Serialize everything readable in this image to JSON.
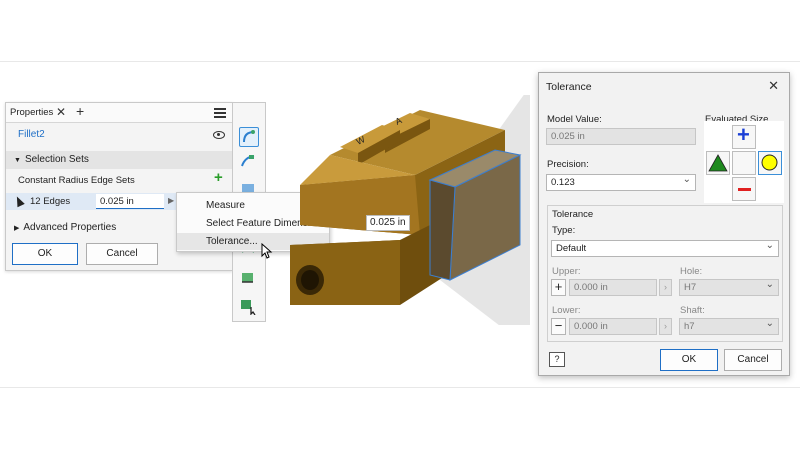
{
  "properties": {
    "tab_label": "Properties",
    "tab_close": "✕",
    "tab_add": "+",
    "feature_name": "Fillet2",
    "selection_sets_header": "Selection Sets",
    "edge_sets_label": "Constant Radius Edge Sets",
    "edges_label": "12 Edges",
    "radius_value": "0.025 in",
    "advanced_header": "Advanced Properties",
    "ok_label": "OK",
    "cancel_label": "Cancel"
  },
  "context_menu": {
    "items": [
      "Measure",
      "Select Feature Dimension",
      "Tolerance..."
    ],
    "highlighted_index": 2
  },
  "dimension_label": "0.025 in",
  "model_engraving": [
    "W",
    "A"
  ],
  "tolerance_dialog": {
    "title": "Tolerance",
    "model_value_label": "Model Value:",
    "model_value": "0.025 in",
    "precision_label": "Precision:",
    "precision_value": "0.123",
    "evaluated_size_label": "Evaluated Size",
    "tolerance_group_label": "Tolerance",
    "type_label": "Type:",
    "type_value": "Default",
    "upper_label": "Upper:",
    "upper_value": "0.000 in",
    "lower_label": "Lower:",
    "lower_value": "0.000 in",
    "hole_label": "Hole:",
    "hole_value": "H7",
    "shaft_label": "Shaft:",
    "shaft_value": "h7",
    "ok_label": "OK",
    "cancel_label": "Cancel"
  },
  "colors": {
    "accent": "#1f6fc6",
    "model_body": "#8b6414",
    "plus_green": "#2a9d2a",
    "triangle_green": "#1e8a1e",
    "circle_yellow": "#ffff00",
    "minus_red": "#e02020",
    "plus_blue": "#1a3fd6"
  }
}
